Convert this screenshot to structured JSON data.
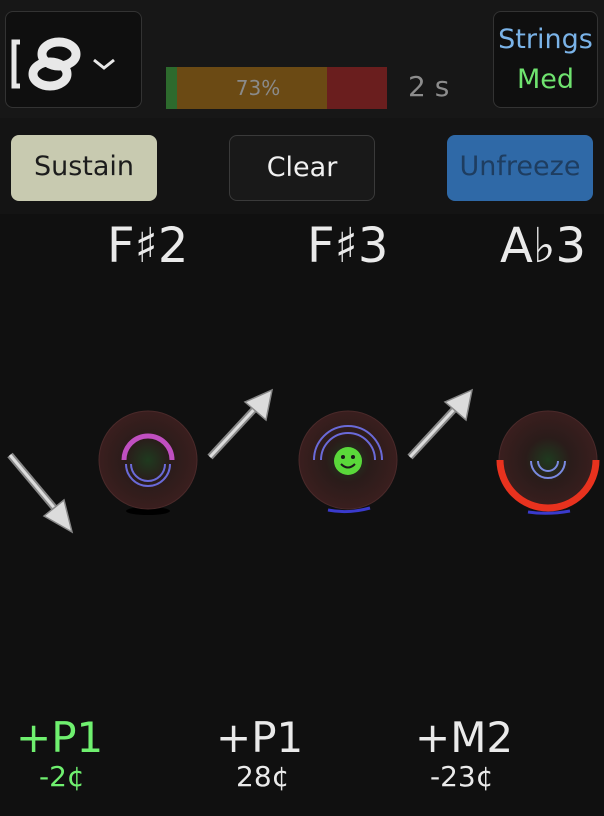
{
  "header": {
    "progress_percent": 73,
    "progress_label": "73%",
    "duration_label": "2 s",
    "instrument": {
      "line1": "Strings",
      "line2": "Med"
    }
  },
  "toolbar": {
    "sustain_label": "Sustain",
    "clear_label": "Clear",
    "unfreeze_label": "Unfreeze"
  },
  "notes": [
    {
      "name": "F♯2",
      "interval": "+P1",
      "cents": "-2¢"
    },
    {
      "name": "F♯3",
      "interval": "+P1",
      "cents": "28¢"
    },
    {
      "name": "A♭3",
      "interval": "+M2",
      "cents": "-23¢"
    }
  ],
  "colors": {
    "accent_blue": "#2f69a7",
    "good_green": "#6ff06f",
    "warn_red": "#e8321e",
    "ring_purple": "#c04fc0"
  }
}
